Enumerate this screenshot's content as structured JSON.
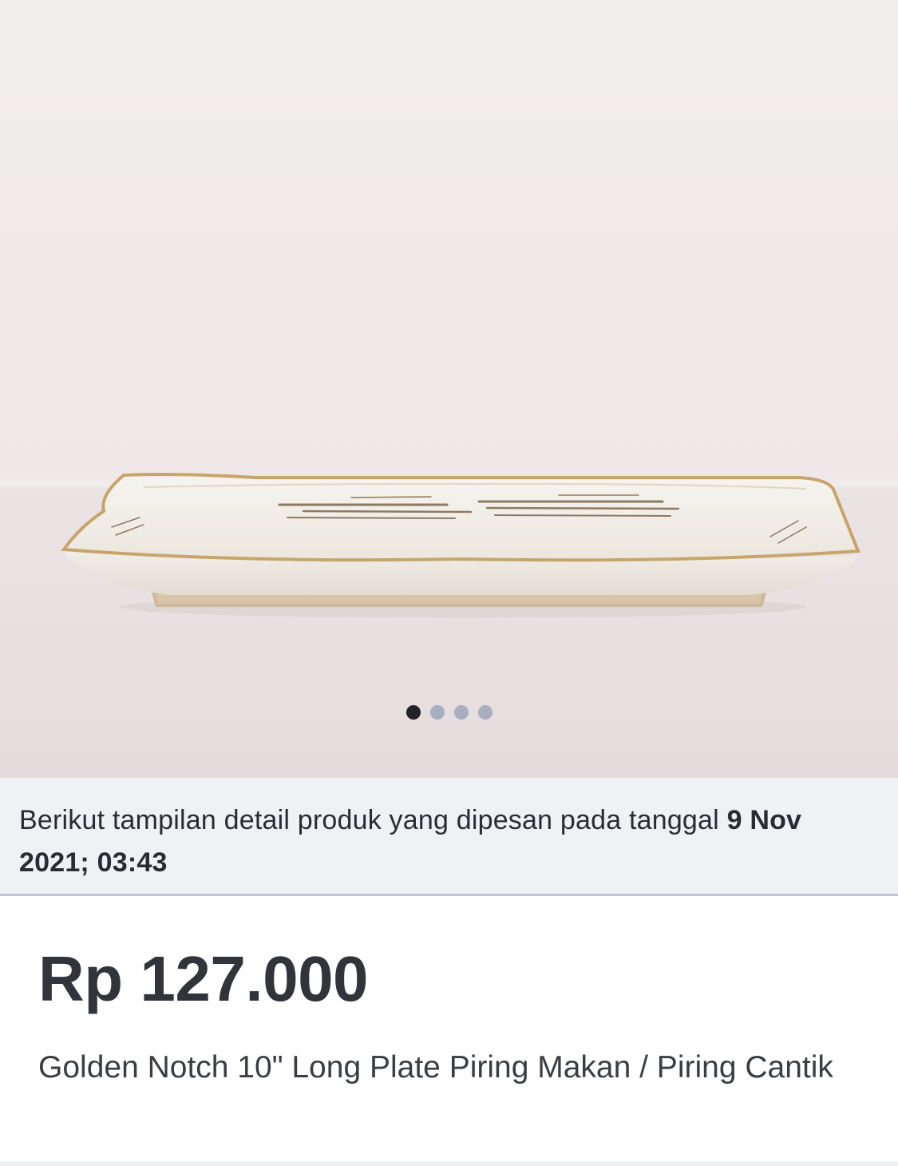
{
  "gallery": {
    "image_alt": "Golden Notch 10\" Long Plate",
    "slide_count": 4,
    "active_slide": 1
  },
  "banner": {
    "text": "Berikut tampilan detail produk yang dipesan pada tanggal ",
    "date": "9 Nov 2021; 03:43"
  },
  "product": {
    "price": "Rp 127.000",
    "title": "Golden Notch 10\" Long Plate Piring Makan / Piring Cantik"
  },
  "colors": {
    "dot_active": "#222326",
    "dot_inactive": "#a9adc0",
    "banner_bg": "#f0f1f5",
    "gold_rim": "#c9a46a"
  }
}
